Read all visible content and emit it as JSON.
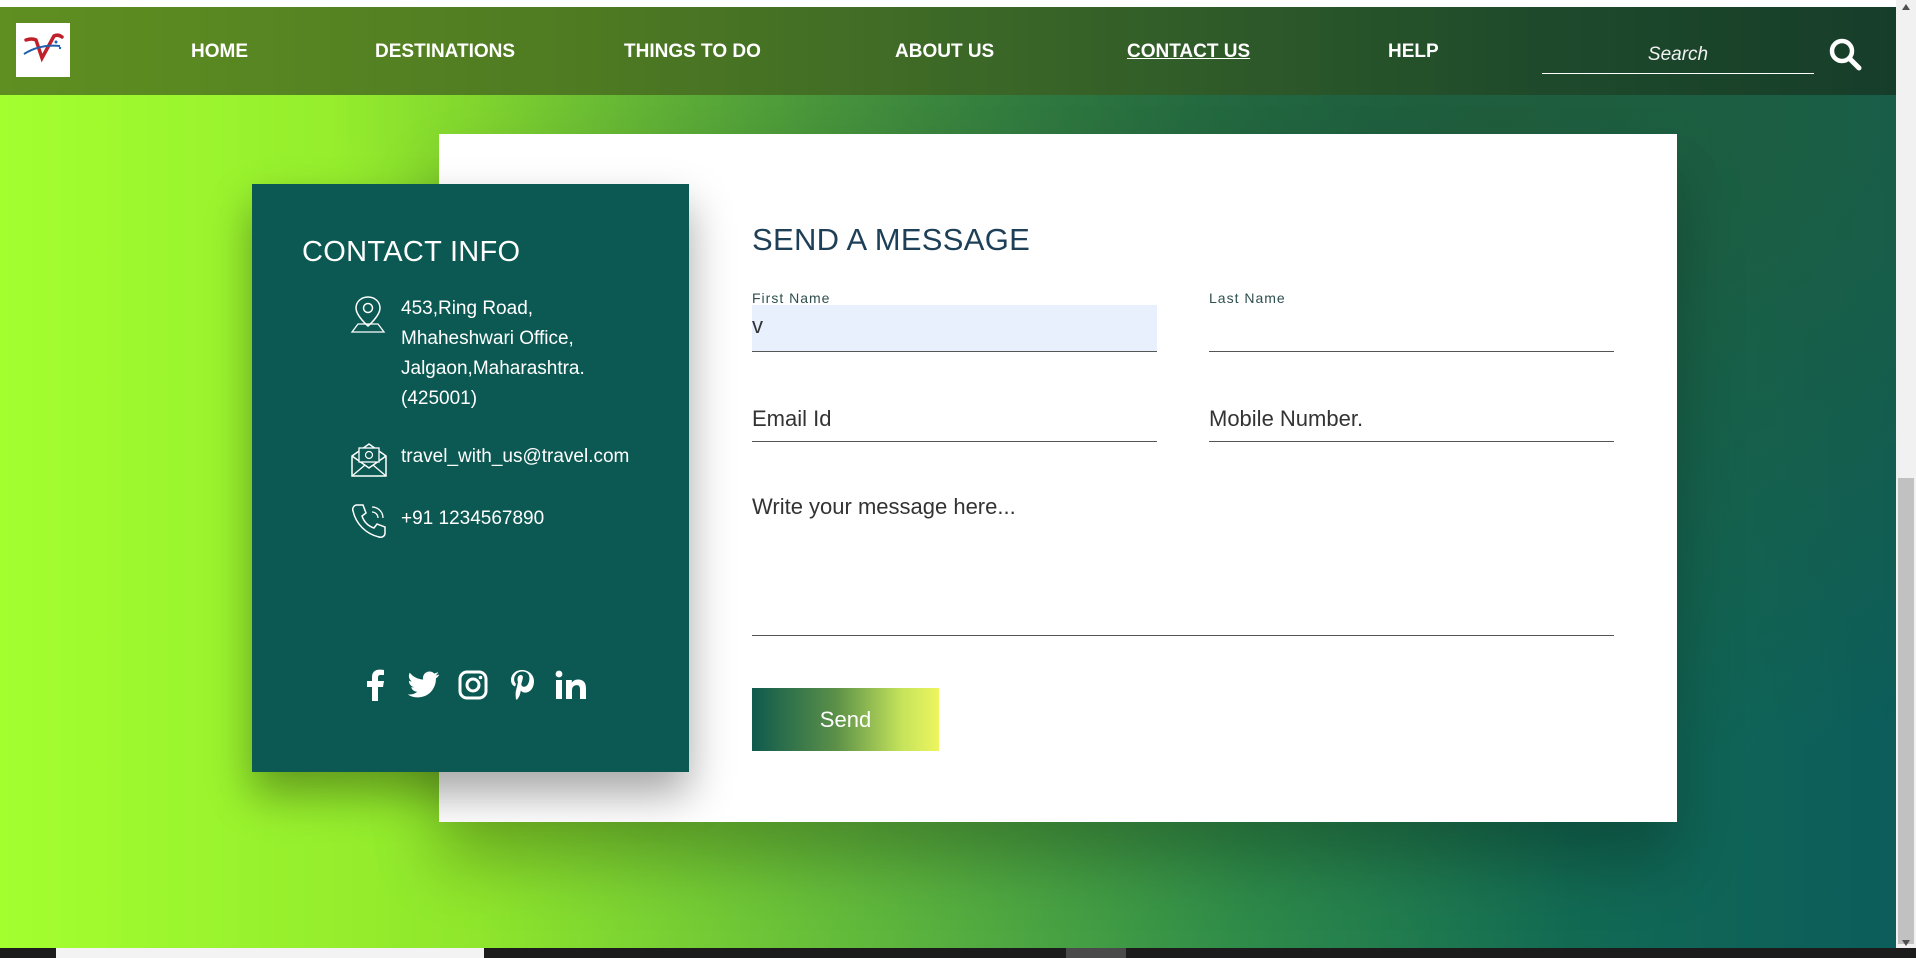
{
  "nav": {
    "items": [
      {
        "label": "HOME",
        "active": false
      },
      {
        "label": "DESTINATIONS",
        "active": false
      },
      {
        "label": "THINGS TO DO",
        "active": false
      },
      {
        "label": "ABOUT US",
        "active": false
      },
      {
        "label": "CONTACT US",
        "active": true
      },
      {
        "label": "HELP",
        "active": false
      }
    ],
    "search_placeholder": "Search",
    "search_icon": "search-icon",
    "logo_icon": "brand-logo-v"
  },
  "contact_info": {
    "title": "CONTACT INFO",
    "address_lines": [
      "453,Ring Road,",
      "Mhaheshwari Office,",
      "Jalgaon,Maharashtra.",
      "(425001)"
    ],
    "email": "travel_with_us@travel.com",
    "phone": "+91 1234567890",
    "icons": [
      "location-pin-icon",
      "mail-icon",
      "phone-icon"
    ],
    "social": [
      "facebook-icon",
      "twitter-icon",
      "instagram-icon",
      "pinterest-icon",
      "linkedin-icon"
    ]
  },
  "form": {
    "title": "SEND A MESSAGE",
    "first_name_label": "First Name",
    "first_name_value": "v",
    "last_name_label": "Last Name",
    "last_name_value": "",
    "email_placeholder": "Email Id",
    "mobile_placeholder": "Mobile Number.",
    "message_placeholder": "Write your message here...",
    "send_label": "Send"
  },
  "colors": {
    "panel": "#0b5952",
    "title": "#1d3f57",
    "accent_green": "#a4ff2f"
  }
}
